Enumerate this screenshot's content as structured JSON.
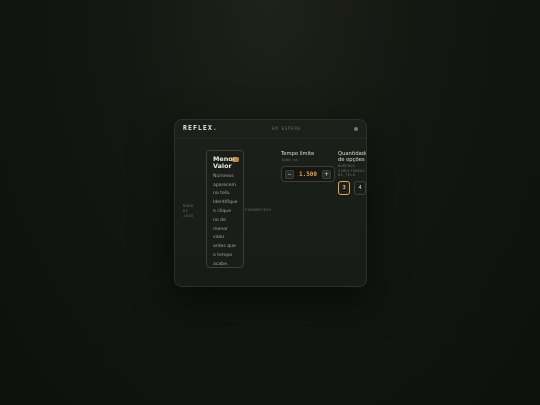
{
  "header": {
    "brand": "REFLEX",
    "brand_dot": ".",
    "status": "EM ESPERA"
  },
  "mode": {
    "section_label": "MODO DE JOGO",
    "selected": {
      "title": "Menor Valor",
      "description": "Números aparecem na tela. Identifique e clique no de menor valor antes que o tempo acabe."
    }
  },
  "params": {
    "section_label": "PARÂMETROS",
    "time_limit": {
      "title": "Tempo limite",
      "hint": "1000 ms",
      "value": "1.500",
      "minus": "−",
      "plus": "+"
    },
    "quantity": {
      "title": "Quantidade de opções",
      "hint": "números simultâneos na tela",
      "options": [
        "3",
        "4"
      ],
      "selected": "3"
    }
  },
  "colors": {
    "accent": "#e0a64a",
    "card_bg": "#1b1e1a",
    "page_bg": "#131611"
  }
}
